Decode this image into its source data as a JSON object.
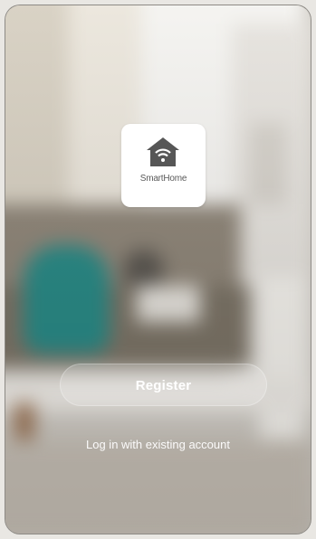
{
  "app": {
    "brand_name": "SmartHome",
    "logo_icon": "house-wifi-icon"
  },
  "actions": {
    "register_label": "Register",
    "login_label": "Log in with existing account"
  },
  "colors": {
    "logo_tile_bg": "#ffffff",
    "logo_house": "#555555",
    "button_text": "#ffffff"
  }
}
